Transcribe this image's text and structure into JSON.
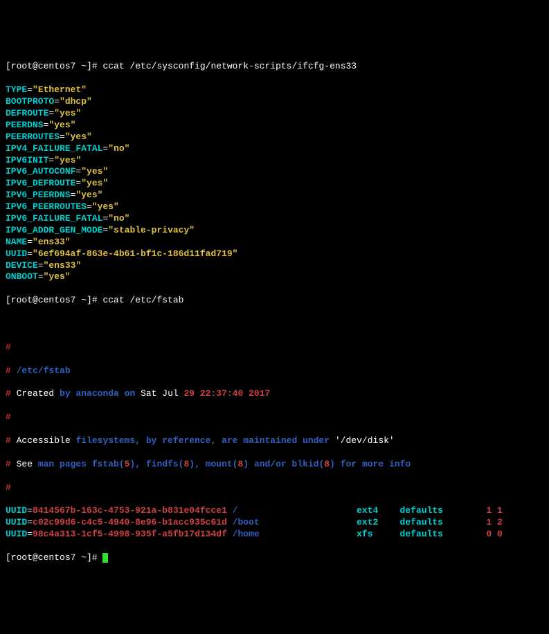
{
  "prompt1": {
    "user_host": "[root@centos7 ~]# ",
    "cmd": "ccat /etc/sysconfig/network-scripts/ifcfg-ens33"
  },
  "kv": [
    {
      "k": "TYPE",
      "eq": "=",
      "v": "\"Ethernet\""
    },
    {
      "k": "BOOTPROTO",
      "eq": "=",
      "v": "\"dhcp\""
    },
    {
      "k": "DEFROUTE",
      "eq": "=",
      "v": "\"yes\""
    },
    {
      "k": "PEERDNS",
      "eq": "=",
      "v": "\"yes\""
    },
    {
      "k": "PEERROUTES",
      "eq": "=",
      "v": "\"yes\""
    },
    {
      "k": "IPV4_FAILURE_FATAL",
      "eq": "=",
      "v": "\"no\""
    },
    {
      "k": "IPV6INIT",
      "eq": "=",
      "v": "\"yes\""
    },
    {
      "k": "IPV6_AUTOCONF",
      "eq": "=",
      "v": "\"yes\""
    },
    {
      "k": "IPV6_DEFROUTE",
      "eq": "=",
      "v": "\"yes\""
    },
    {
      "k": "IPV6_PEERDNS",
      "eq": "=",
      "v": "\"yes\""
    },
    {
      "k": "IPV6_PEERROUTES",
      "eq": "=",
      "v": "\"yes\""
    },
    {
      "k": "IPV6_FAILURE_FATAL",
      "eq": "=",
      "v": "\"no\""
    },
    {
      "k": "IPV6_ADDR_GEN_MODE",
      "eq": "=",
      "v": "\"stable-privacy\""
    },
    {
      "k": "NAME",
      "eq": "=",
      "v": "\"ens33\""
    },
    {
      "k": "UUID",
      "eq": "=",
      "v": "\"6ef694af-863e-4b61-bf1c-186d11fad719\""
    },
    {
      "k": "DEVICE",
      "eq": "=",
      "v": "\"ens33\""
    },
    {
      "k": "ONBOOT",
      "eq": "=",
      "v": "\"yes\""
    }
  ],
  "prompt2": {
    "user_host": "[root@centos7 ~]# ",
    "cmd": "ccat /etc/fstab"
  },
  "fstab": {
    "hash1": "#",
    "l1": {
      "hash": "#",
      "sp": " ",
      "path": "/etc/fstab"
    },
    "l2": {
      "hash": "#",
      "sp": " Created ",
      "mid": "by anaconda on ",
      "date": "Sat Jul ",
      "rest": "29 22:37:40 2017"
    },
    "hash2": "#",
    "l3": {
      "hash": "#",
      "sp": " Accessible ",
      "mid": "filesystems, by reference, are maintained under ",
      "q": "'/dev/disk'"
    },
    "l4": {
      "hash": "#",
      "sp": " See ",
      "t1": "man pages fstab(",
      "n1": "5",
      "t2": "), findfs(",
      "n2": "8",
      "t3": "), mount(",
      "n3": "8",
      "t4": ") and/or blkid(",
      "n4": "8",
      "t5": ") for more info"
    },
    "hash3": "#",
    "rows": [
      {
        "u": "UUID",
        "eq": "=",
        "val": "8414567b-163c-4753-921a-b831e04fcce1 ",
        "mnt": "/",
        "fs": "ext4",
        "opt": "defaults",
        "dp": "1 1"
      },
      {
        "u": "UUID",
        "eq": "=",
        "val": "c02c99d6-c4c5-4940-8e96-b1acc935c61d ",
        "mnt": "/boot",
        "fs": "ext2",
        "opt": "defaults",
        "dp": "1 2"
      },
      {
        "u": "UUID",
        "eq": "=",
        "val": "98c4a313-1cf5-4998-935f-a5fb17d134df ",
        "mnt": "/home",
        "fs": "xfs",
        "opt": "defaults",
        "dp": "0 0"
      }
    ]
  },
  "prompt3": {
    "user_host": "[root@centos7 ~]# "
  }
}
